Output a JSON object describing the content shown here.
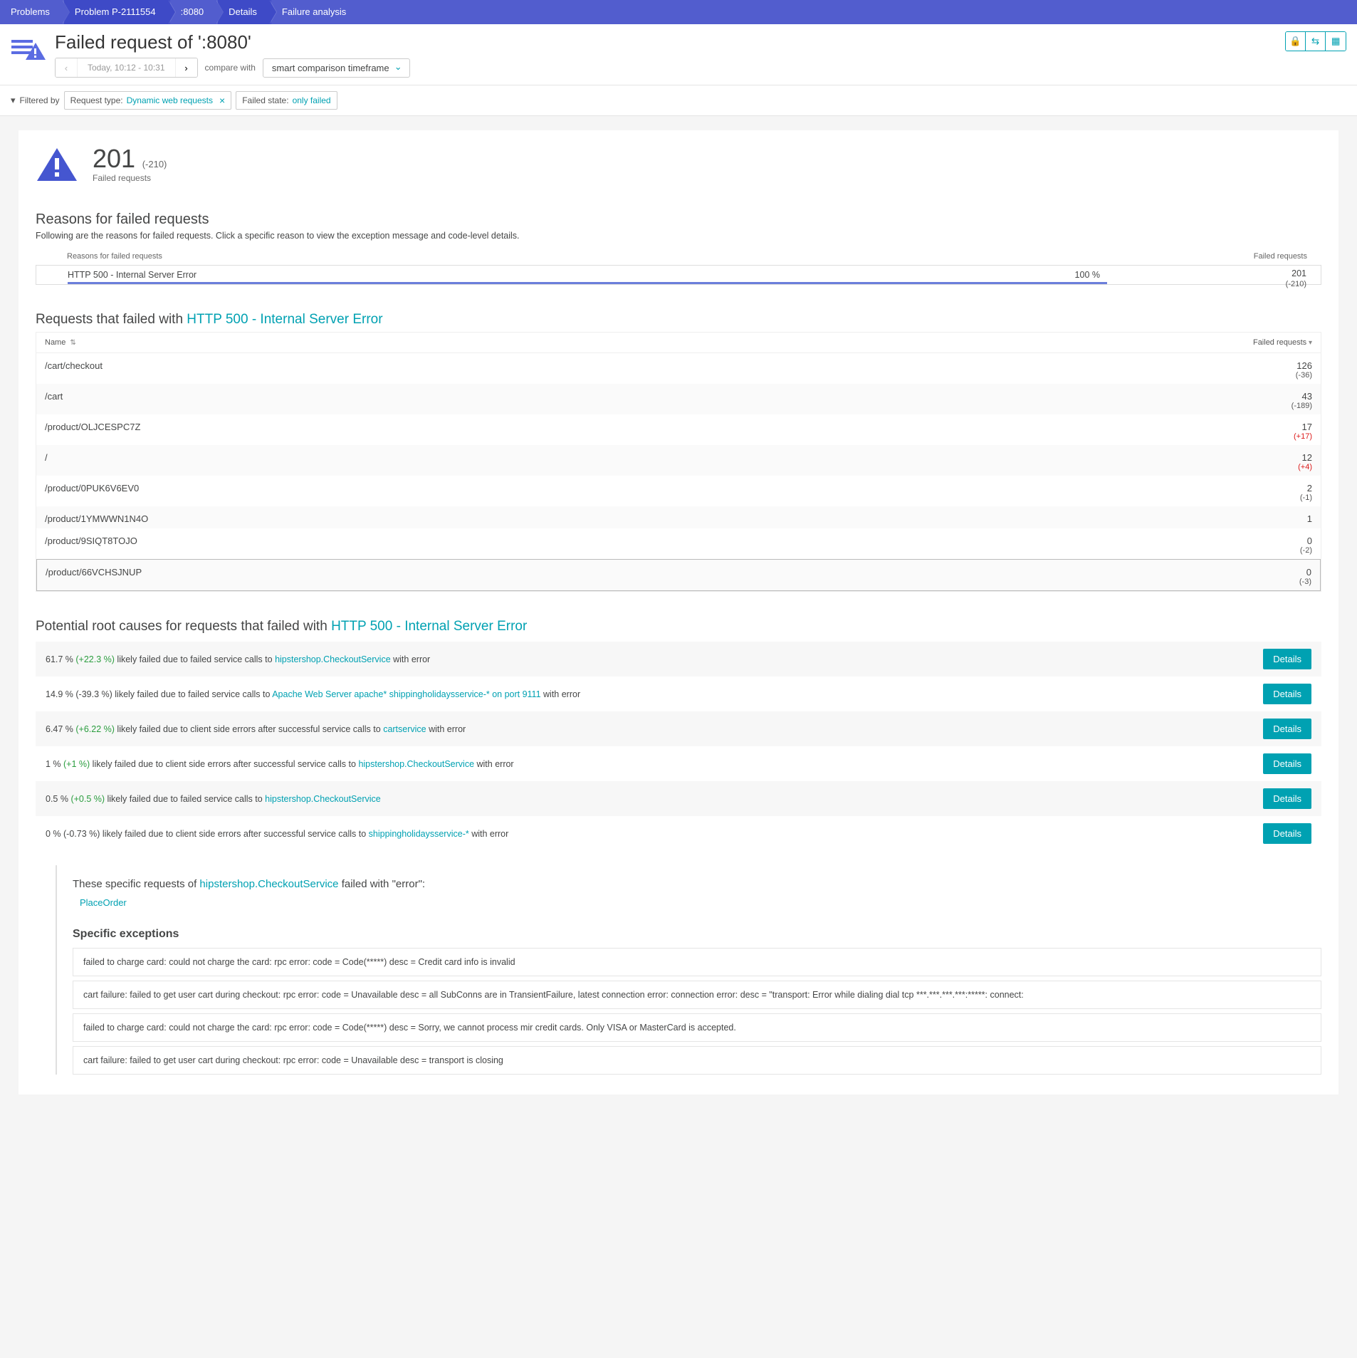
{
  "breadcrumb": [
    "Problems",
    "Problem P-2111554",
    ":8080",
    "Details",
    "Failure analysis"
  ],
  "header": {
    "title": "Failed request of ':8080'",
    "time_text": "Today, 10:12 - 10:31",
    "compare_label": "compare with",
    "compare_value": "smart comparison timeframe"
  },
  "filter": {
    "label": "Filtered by",
    "chips": [
      {
        "label": "Request type:",
        "value": "Dynamic web requests",
        "removable": true
      },
      {
        "label": "Failed state:",
        "value": "only failed",
        "removable": false
      }
    ]
  },
  "stat": {
    "count": "201",
    "delta": "(-210)",
    "sub": "Failed requests"
  },
  "reasons_section": {
    "title": "Reasons for failed requests",
    "sub": "Following are the reasons for failed requests. Click a specific reason to view the exception message and code-level details.",
    "head_left": "Reasons for failed requests",
    "head_right": "Failed requests",
    "row": {
      "name": "HTTP 500 - Internal Server Error",
      "pct": "100 %",
      "count": "201",
      "delta": "(-210)"
    }
  },
  "requests_section": {
    "title_prefix": "Requests that failed with ",
    "title_link": "HTTP 500 - Internal Server Error",
    "head_name": "Name",
    "head_count": "Failed requests",
    "rows": [
      {
        "name": "/cart/checkout",
        "count": "126",
        "delta": "(-36)",
        "red": false
      },
      {
        "name": "/cart",
        "count": "43",
        "delta": "(-189)",
        "red": false
      },
      {
        "name": "/product/OLJCESPC7Z",
        "count": "17",
        "delta": "(+17)",
        "red": true
      },
      {
        "name": "/",
        "count": "12",
        "delta": "(+4)",
        "red": true
      },
      {
        "name": "/product/0PUK6V6EV0",
        "count": "2",
        "delta": "(-1)",
        "red": false
      },
      {
        "name": "/product/1YMWWN1N4O",
        "count": "1",
        "delta": "",
        "red": false
      },
      {
        "name": "/product/9SIQT8TOJO",
        "count": "0",
        "delta": "(-2)",
        "red": false
      },
      {
        "name": "/product/66VCHSJNUP",
        "count": "0",
        "delta": "(-3)",
        "red": false
      }
    ]
  },
  "root_section": {
    "title_prefix": "Potential root causes for requests that failed with ",
    "title_link": "HTTP 500 - Internal Server Error",
    "rows": [
      {
        "pct": "61.7 %",
        "dlt": "(+22.3 %)",
        "dlt_style": "green",
        "text1": " likely failed due to failed service calls to ",
        "svc": "hipstershop.CheckoutService",
        "text2": " with error"
      },
      {
        "pct": "14.9 %",
        "dlt": "(-39.3 %)",
        "dlt_style": "plain",
        "text1": " likely failed due to failed service calls to ",
        "svc": "Apache Web Server apache* shippingholidaysservice-* on port 9111",
        "text2": " with error"
      },
      {
        "pct": "6.47 %",
        "dlt": "(+6.22 %)",
        "dlt_style": "green",
        "text1": " likely failed due to client side errors after successful service calls to ",
        "svc": "cartservice",
        "text2": " with error"
      },
      {
        "pct": "1 %",
        "dlt": "(+1 %)",
        "dlt_style": "green",
        "text1": " likely failed due to client side errors after successful service calls to ",
        "svc": "hipstershop.CheckoutService",
        "text2": " with error"
      },
      {
        "pct": "0.5 %",
        "dlt": "(+0.5 %)",
        "dlt_style": "green",
        "text1": " likely failed due to failed service calls to ",
        "svc": "hipstershop.CheckoutService",
        "text2": ""
      },
      {
        "pct": "0 %",
        "dlt": "(-0.73 %)",
        "dlt_style": "plain",
        "text1": " likely failed due to client side errors after successful service calls to ",
        "svc": "shippingholidaysservice-*",
        "text2": " with error"
      }
    ],
    "details_btn": "Details"
  },
  "inset": {
    "line_prefix": "These specific requests of ",
    "svc": "hipstershop.CheckoutService",
    "line_suffix": " failed with \"error\":",
    "method": "PlaceOrder",
    "exc_title": "Specific exceptions",
    "exceptions": [
      "failed to charge card: could not charge the card: rpc error: code = Code(*****) desc = Credit card info is invalid",
      "cart failure: failed to get user cart during checkout: rpc error: code = Unavailable desc = all SubConns are in TransientFailure, latest connection error: connection error: desc = \"transport: Error while dialing dial tcp ***.***.***.***:*****: connect:",
      "failed to charge card: could not charge the card: rpc error: code = Code(*****) desc = Sorry, we cannot process mir credit cards. Only VISA or MasterCard is accepted.",
      "cart failure: failed to get user cart during checkout: rpc error: code = Unavailable desc = transport is closing"
    ]
  }
}
